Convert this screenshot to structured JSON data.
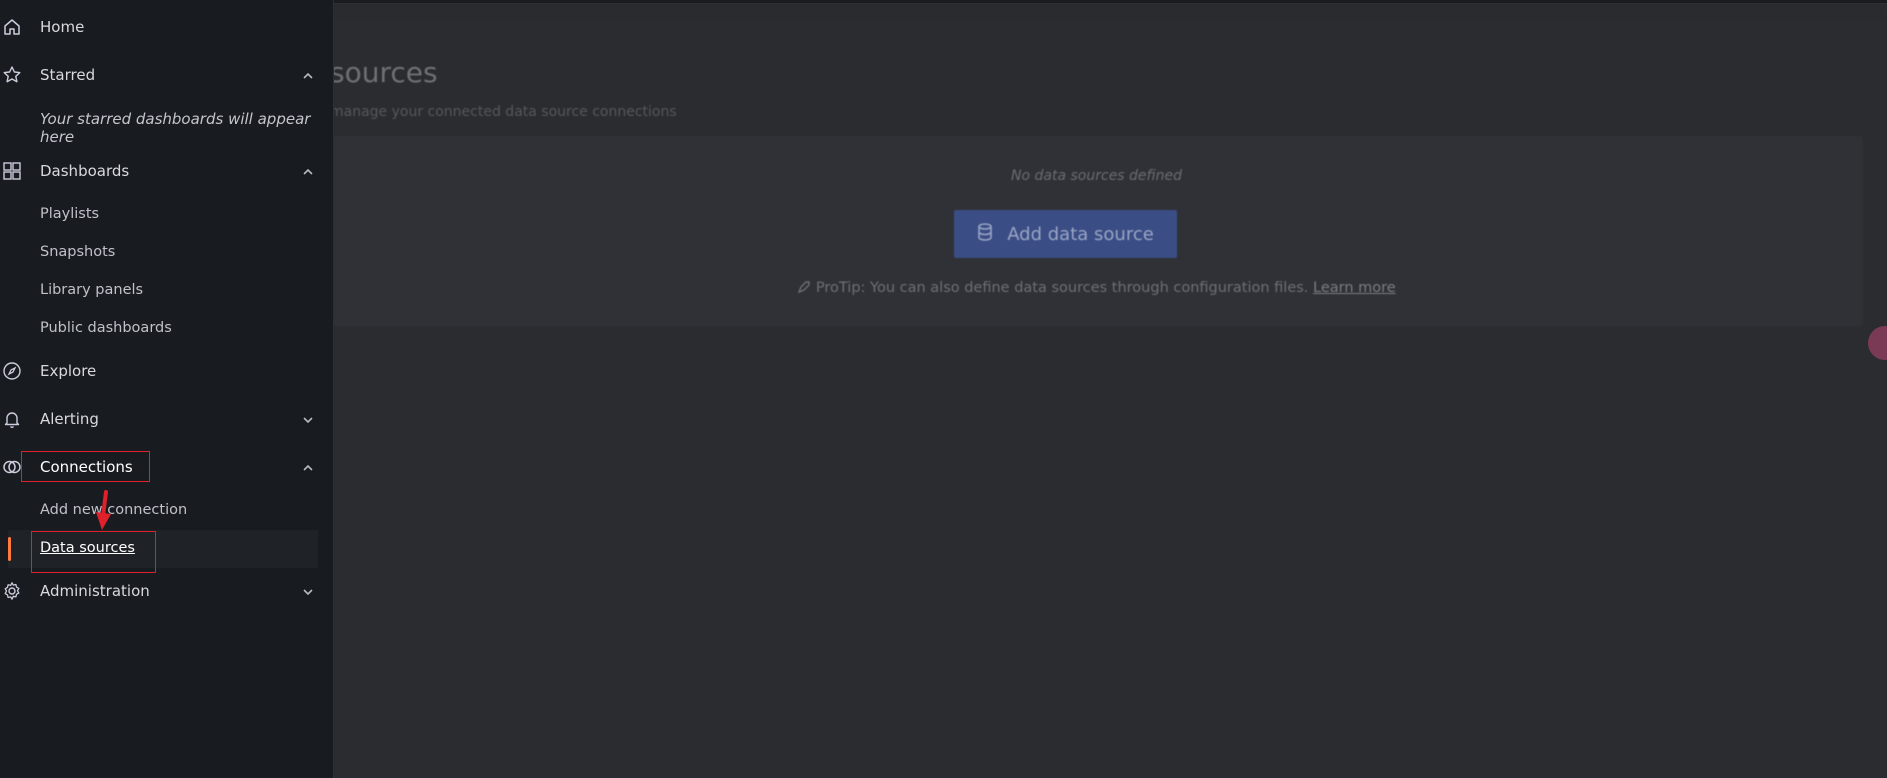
{
  "page": {
    "title": "sources",
    "subtitle": "manage your connected data source connections",
    "empty_text": "No data sources defined",
    "add_button_label": "Add data source",
    "protip_text": "ProTip: You can also define data sources through configuration files.",
    "protip_link": "Learn more"
  },
  "sidebar": {
    "home": "Home",
    "starred": "Starred",
    "starred_hint": "Your starred dashboards will appear here",
    "dashboards": "Dashboards",
    "dashboards_children": [
      "Playlists",
      "Snapshots",
      "Library panels",
      "Public dashboards"
    ],
    "explore": "Explore",
    "alerting": "Alerting",
    "connections": "Connections",
    "connections_children": [
      "Add new connection",
      "Data sources"
    ],
    "administration": "Administration"
  },
  "icons": {
    "home": "home-icon",
    "starred": "star-icon",
    "dashboards": "apps-icon",
    "explore": "compass-icon",
    "alerting": "bell-icon",
    "connections": "link-icon",
    "administration": "gear-icon"
  },
  "colors": {
    "active_indicator": "#ff7a3c",
    "annotation": "#e0202a",
    "primary_button": "#3a4d85"
  }
}
